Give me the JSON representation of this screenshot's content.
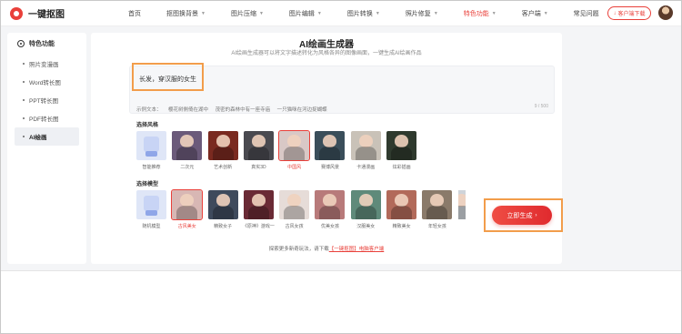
{
  "brand": {
    "name": "一键抠图"
  },
  "nav": {
    "items": [
      {
        "label": "首页",
        "caret": ""
      },
      {
        "label": "抠图换背景",
        "caret": "▼"
      },
      {
        "label": "图片压缩",
        "caret": "▼"
      },
      {
        "label": "图片编辑",
        "caret": "▼"
      },
      {
        "label": "图片转换",
        "caret": "▼"
      },
      {
        "label": "照片修复",
        "caret": "▼"
      },
      {
        "label": "特色功能",
        "caret": "▼"
      },
      {
        "label": "客户端",
        "caret": "▼"
      },
      {
        "label": "常见问题",
        "caret": ""
      }
    ],
    "download_label": "客户端下载",
    "download_icon": "↓"
  },
  "sidebar": {
    "title": "特色功能",
    "items": [
      {
        "label": "照片变漫画"
      },
      {
        "label": "Word转长图"
      },
      {
        "label": "PPT转长图"
      },
      {
        "label": "PDF转长图"
      },
      {
        "label": "AI绘画"
      }
    ]
  },
  "main": {
    "title": "AI绘画生成器",
    "subtitle": "AI绘画生成器可以将文字描述转化为风格各异的图像画面，一键生成AI绘画作品",
    "prompt_value": "长发，穿汉服的女生",
    "prompt_count": "9 / 500",
    "examples_label": "示例文本：",
    "examples": [
      "樱花树側倚在湖中",
      "茂密的森林中有一座寺庙",
      "一只猫咪在河边捉蝴蝶"
    ],
    "style_section": "选择风格",
    "styles": [
      {
        "label": "智能推荐",
        "color": "#dfe6f7"
      },
      {
        "label": "二次元",
        "color": "#6b5a7a"
      },
      {
        "label": "艺术创新",
        "color": "#7a2a20"
      },
      {
        "label": "真实3D",
        "color": "#4a4a50"
      },
      {
        "label": "中国风",
        "color": "#d9c8c6"
      },
      {
        "label": "赛博风景",
        "color": "#3a4e5a"
      },
      {
        "label": "卡通漫画",
        "color": "#c9c2b8"
      },
      {
        "label": "炫彩插画",
        "color": "#2f3a2e"
      }
    ],
    "model_section": "选择模型",
    "models": [
      {
        "label": "随机模型",
        "color": "#dfe6f7"
      },
      {
        "label": "古风美女",
        "color": "#d8b7b4"
      },
      {
        "label": "精致女子",
        "color": "#3e4a5c"
      },
      {
        "label": "《原神》游戏一",
        "color": "#6a2a35"
      },
      {
        "label": "古风女孩",
        "color": "#e6dcd8"
      },
      {
        "label": "优美女孩",
        "color": "#b87a7a"
      },
      {
        "label": "汉服美女",
        "color": "#5f8a7a"
      },
      {
        "label": "精致美女",
        "color": "#b26a5a"
      },
      {
        "label": "年轻女孩",
        "color": "#8a7a6a"
      }
    ],
    "generate_label": "立即生成",
    "generate_arrow": "›",
    "bottom_note_prefix": "探索更多新奇玩法，请下载",
    "bottom_note_link": "【一键抠图】电脑客户端"
  },
  "colors": {
    "accent": "#e9403a",
    "highlight": "#f29d4b"
  }
}
